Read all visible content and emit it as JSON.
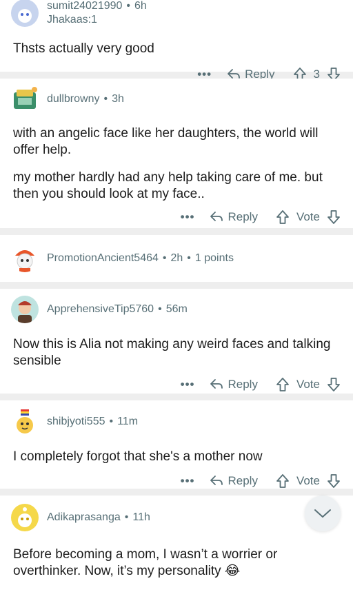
{
  "comments": [
    {
      "user": "sumit24021990",
      "age": "6h",
      "flair": "Jhakaas:1",
      "paragraphs": [
        "Thsts actually very good"
      ],
      "more": "•••",
      "reply": "Reply",
      "score": "3"
    },
    {
      "user": "dullbrowny",
      "age": "3h",
      "paragraphs": [
        "with an angelic face like her daughters, the world will offer help.",
        "my mother hardly had any help taking care of me. but then you should look at my face.."
      ],
      "more": "•••",
      "reply": "Reply",
      "score": "Vote"
    },
    {
      "user": "PromotionAncient5464",
      "age": "2h",
      "points": "1 points"
    },
    {
      "user": "ApprehensiveTip5760",
      "age": "56m",
      "paragraphs": [
        "Now this is Alia not making any weird faces and talking sensible"
      ],
      "more": "•••",
      "reply": "Reply",
      "score": "Vote"
    },
    {
      "user": "shibjyoti555",
      "age": "11m",
      "paragraphs": [
        "I completely forgot that she's a mother now"
      ],
      "more": "•••",
      "reply": "Reply",
      "score": "Vote"
    },
    {
      "user": "Adikaprasanga",
      "age": "11h",
      "paragraphs": [
        "Before becoming a mom, I wasn’t a worrier or overthinker. Now, it’s my personality 😂"
      ]
    }
  ],
  "colors": {
    "separator": "#eeeeee",
    "meta": "#576f76",
    "text": "#1c1c1c"
  },
  "icons": {
    "reply": "reply-arrow-icon",
    "upvote": "upvote-arrow-icon",
    "downvote": "downvote-arrow-icon",
    "scroll": "chevron-down-icon"
  }
}
